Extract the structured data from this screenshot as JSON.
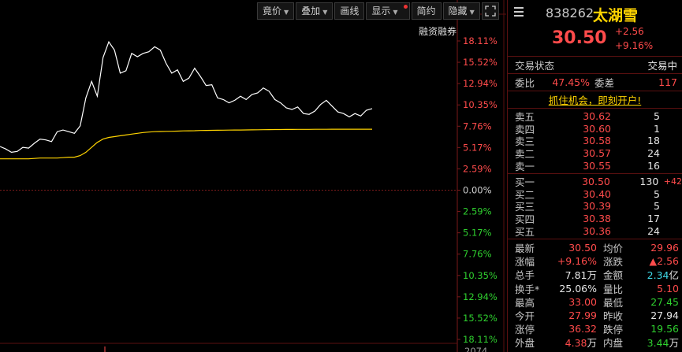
{
  "toolbar": {
    "items": [
      {
        "label": "竟价",
        "dropdown": true
      },
      {
        "label": "叠加",
        "dropdown": true
      },
      {
        "label": "画线",
        "dropdown": false
      },
      {
        "label": "显示",
        "dropdown": true,
        "badge": true
      },
      {
        "label": "简约",
        "dropdown": false
      },
      {
        "label": "隐藏",
        "dropdown": true
      }
    ],
    "expand_icon": "expand-icon"
  },
  "chart_label": "融资融券",
  "chart_data": {
    "type": "line",
    "pre_close": 27.94,
    "y_tick_labels_up": [
      "18.11%",
      "15.52%",
      "12.94%",
      "10.35%",
      "7.76%",
      "5.17%",
      "2.59%"
    ],
    "zero_label": "0.00%",
    "y_tick_labels_down": [
      "2.59%",
      "5.17%",
      "7.76%",
      "10.35%",
      "12.94%",
      "15.52%",
      "18.11%"
    ],
    "ylim_pct": [
      -18.11,
      18.11
    ],
    "bottom_label": "2074",
    "series": [
      {
        "color": "#ffffff",
        "values_pct": [
          5.3,
          5.0,
          4.6,
          4.7,
          5.2,
          5.1,
          5.7,
          6.2,
          6.1,
          5.9,
          7.1,
          7.3,
          7.1,
          6.9,
          7.8,
          11.2,
          13.2,
          11.4,
          16.1,
          18.0,
          17.0,
          14.2,
          14.5,
          16.6,
          16.2,
          16.6,
          16.8,
          17.4,
          17.0,
          15.4,
          14.2,
          14.6,
          13.2,
          13.6,
          14.8,
          13.8,
          12.7,
          12.8,
          11.2,
          11.0,
          10.6,
          10.9,
          11.4,
          11.0,
          11.6,
          11.8,
          12.4,
          12.0,
          11.0,
          10.6,
          10.0,
          9.8,
          10.1,
          9.3,
          9.2,
          9.6,
          10.4,
          10.9,
          10.2,
          9.5,
          9.3,
          8.9,
          9.3,
          9.0,
          9.7,
          9.9
        ]
      },
      {
        "color": "#ffd400",
        "values_pct": [
          3.8,
          3.8,
          3.8,
          3.8,
          3.8,
          3.8,
          3.85,
          3.9,
          3.9,
          3.9,
          3.9,
          3.95,
          4.0,
          4.0,
          4.2,
          4.6,
          5.2,
          5.8,
          6.2,
          6.4,
          6.5,
          6.6,
          6.7,
          6.8,
          6.9,
          7.0,
          7.05,
          7.1,
          7.12,
          7.14,
          7.15,
          7.17,
          7.2,
          7.21,
          7.22,
          7.24,
          7.25,
          7.26,
          7.27,
          7.28,
          7.29,
          7.3,
          7.3,
          7.31,
          7.32,
          7.33,
          7.34,
          7.35,
          7.36,
          7.36,
          7.37,
          7.37,
          7.38,
          7.38,
          7.38,
          7.39,
          7.39,
          7.39,
          7.4,
          7.4,
          7.4,
          7.4,
          7.4,
          7.4,
          7.4,
          7.4
        ]
      }
    ]
  },
  "stock": {
    "code": "838262",
    "name": "太湖雪",
    "price": "30.50",
    "change": "+2.56",
    "change_pct": "+9.16%"
  },
  "status": {
    "label": "交易状态",
    "value": "交易中"
  },
  "ratio": {
    "label1": "委比",
    "value1": "47.45%",
    "label2": "委差",
    "value2": "117"
  },
  "promo": "抓住机会，即刻开户!",
  "asks": [
    {
      "label": "卖五",
      "price": "30.62",
      "vol": "5",
      "extra": ""
    },
    {
      "label": "卖四",
      "price": "30.60",
      "vol": "1",
      "extra": ""
    },
    {
      "label": "卖三",
      "price": "30.58",
      "vol": "18",
      "extra": ""
    },
    {
      "label": "卖二",
      "price": "30.57",
      "vol": "24",
      "extra": ""
    },
    {
      "label": "卖一",
      "price": "30.55",
      "vol": "16",
      "extra": ""
    }
  ],
  "bids": [
    {
      "label": "买一",
      "price": "30.50",
      "vol": "130",
      "extra": "+42"
    },
    {
      "label": "买二",
      "price": "30.40",
      "vol": "5",
      "extra": ""
    },
    {
      "label": "买三",
      "price": "30.39",
      "vol": "5",
      "extra": ""
    },
    {
      "label": "买四",
      "price": "30.38",
      "vol": "17",
      "extra": ""
    },
    {
      "label": "买五",
      "price": "30.36",
      "vol": "24",
      "extra": ""
    }
  ],
  "stats": [
    {
      "l1": "最新",
      "v1": "30.50",
      "c1": "red",
      "u1": "",
      "l2": "均价",
      "v2": "29.96",
      "c2": "red",
      "u2": ""
    },
    {
      "l1": "涨幅",
      "v1": "+9.16%",
      "c1": "red",
      "u1": "",
      "l2": "涨跌",
      "v2": "▲2.56",
      "c2": "red",
      "u2": ""
    },
    {
      "l1": "总手",
      "v1": "7.81",
      "c1": "white",
      "u1": "万",
      "l2": "金额",
      "v2": "2.34",
      "c2": "cyan",
      "u2": "亿"
    },
    {
      "l1": "换手*",
      "v1": "25.06%",
      "c1": "white",
      "u1": "",
      "l2": "量比",
      "v2": "5.10",
      "c2": "red",
      "u2": ""
    },
    {
      "l1": "最高",
      "v1": "33.00",
      "c1": "red",
      "u1": "",
      "l2": "最低",
      "v2": "27.45",
      "c2": "green",
      "u2": ""
    },
    {
      "l1": "今开",
      "v1": "27.99",
      "c1": "red",
      "u1": "",
      "l2": "昨收",
      "v2": "27.94",
      "c2": "white",
      "u2": ""
    },
    {
      "l1": "涨停",
      "v1": "36.32",
      "c1": "red",
      "u1": "",
      "l2": "跌停",
      "v2": "19.56",
      "c2": "green",
      "u2": ""
    },
    {
      "l1": "外盘",
      "v1": "4.38",
      "c1": "red",
      "u1": "万",
      "l2": "内盘",
      "v2": "3.44",
      "c2": "green",
      "u2": "万"
    }
  ]
}
